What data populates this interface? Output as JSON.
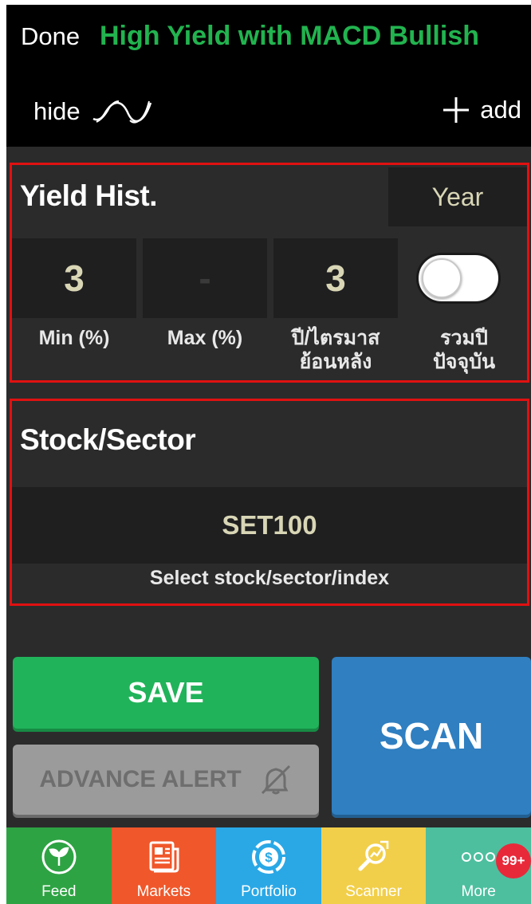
{
  "header": {
    "done_label": "Done",
    "title": "High Yield with MACD Bullish",
    "title_color": "#22b34f",
    "hide_label": "hide",
    "add_label": "add"
  },
  "yield_section": {
    "title": "Yield Hist.",
    "period": "Year",
    "min_value": "3",
    "max_value": "-",
    "lookback_value": "3",
    "include_current_year": false,
    "labels": {
      "min": "Min (%)",
      "max": "Max (%)",
      "lookback_line1": "ปี/ไตรมาส",
      "lookback_line2": "ย้อนหลัง",
      "current_line1": "รวมปี",
      "current_line2": "ปัจจุบัน"
    }
  },
  "stock_section": {
    "title": "Stock/Sector",
    "value": "SET100",
    "hint": "Select stock/sector/index"
  },
  "buttons": {
    "save": "SAVE",
    "advance_alert": "ADVANCE ALERT",
    "scan": "SCAN"
  },
  "tabbar": {
    "items": [
      {
        "label": "Feed",
        "icon": "sprout-icon",
        "color": "#2ea343"
      },
      {
        "label": "Markets",
        "icon": "newspaper-icon",
        "color": "#f0572a"
      },
      {
        "label": "Portfolio",
        "icon": "dollar-coin-icon",
        "color": "#2aa8e6"
      },
      {
        "label": "Scanner",
        "icon": "magnifier-chart-icon",
        "color": "#f2cf4a"
      },
      {
        "label": "More",
        "icon": "dots-icon",
        "color": "#4dbf9f"
      }
    ],
    "badge": "99+"
  }
}
